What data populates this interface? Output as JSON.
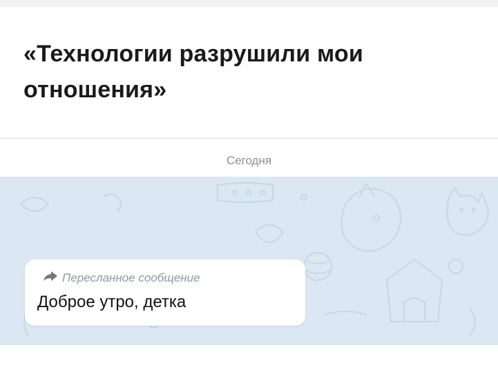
{
  "meme": {
    "title": "«Технологии разрушили мои отношения»"
  },
  "chat": {
    "date_label": "Сегодня",
    "message": {
      "forwarded_label": "Пересланное сообщение",
      "text": "Доброе утро, детка",
      "forward_icon": "forward-arrow-icon"
    },
    "colors": {
      "chat_background": "#dbe7f2",
      "doodles": "#c6d7e6",
      "bubble": "#ffffff",
      "forwarded_label": "#8f979f"
    }
  }
}
